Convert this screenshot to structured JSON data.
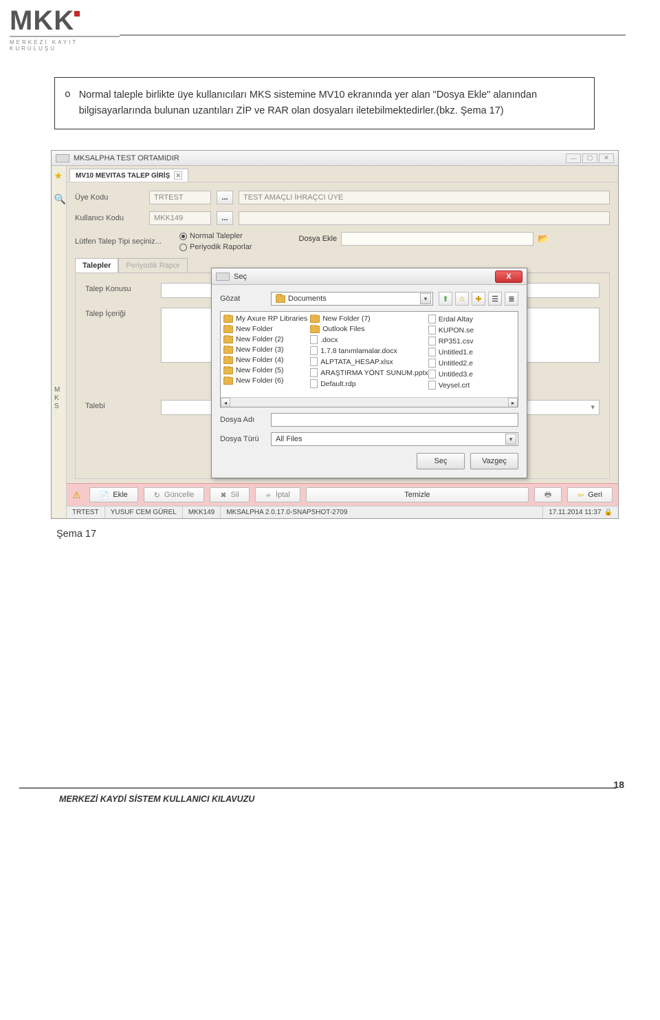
{
  "logo_text": "MKK",
  "logo_sub": "MERKEZİ KAYIT KURULUŞU",
  "textbox_bullet_marker": "o",
  "textbox_text": "Normal taleple birlikte üye kullanıcıları MKS sistemine MV10 ekranında yer alan \"Dosya Ekle\" alanından bilgisayarlarında bulunan uzantıları ZİP ve RAR olan dosyaları iletebilmektedirler.(bkz. Şema 17)",
  "app": {
    "title": "MKSALPHA TEST ORTAMIDIR",
    "tab_title": "MV10 MEVITAS TALEP GİRİŞ",
    "form": {
      "uye_kodu_label": "Üye Kodu",
      "uye_kodu_value": "TRTEST",
      "uye_kodu_desc": "TEST AMAÇLI İHRAÇCI ÜYE",
      "kullanici_kodu_label": "Kullanıcı Kodu",
      "kullanici_kodu_value": "MKK149",
      "talep_tipi_label": "Lütfen Talep Tipi seçiniz...",
      "radio1": "Normal Talepler",
      "radio2": "Periyodik Raporlar",
      "dosya_ekle_label": "Dosya Ekle"
    },
    "tabs2": {
      "t1": "Talepler",
      "t2": "Periyodik Rapor"
    },
    "panel": {
      "talep_konusu": "Talep Konusu",
      "talep_icerigi": "Talep İçeriği",
      "talebi": "Talebi"
    },
    "mks_letters": "M\nK\nS",
    "toolbar": {
      "ekle": "Ekle",
      "guncelle": "Güncelle",
      "sil": "Sil",
      "iptal": "İptal",
      "temizle": "Temizle",
      "geri": "Geri"
    },
    "status": {
      "s1": "TRTEST",
      "s2": "YUSUF CEM GÜREL",
      "s3": "MKK149",
      "s4": "MKSALPHA 2.0.17.0-SNAPSHOT-2709",
      "time": "17.11.2014 11:37"
    }
  },
  "dialog": {
    "title": "Seç",
    "gozat": "Gözat",
    "location": "Documents",
    "col1": [
      "My Axure RP Libraries",
      "New Folder",
      "New Folder (2)",
      "New Folder (3)",
      "New Folder (4)",
      "New Folder (5)",
      "New Folder (6)"
    ],
    "col2": [
      "New Folder (7)",
      "Outlook Files",
      ".docx",
      "1.7.8 tanımlamalar.docx",
      "ALPTATA_HESAP.xlsx",
      "ARAŞTIRMA YÖNT  SUNUM.pptx",
      "Default.rdp"
    ],
    "col3": [
      "Erdal Altay",
      "KUPON.se",
      "RP351.csv",
      "Untitled1.e",
      "Untitled2.e",
      "Untitled3.e",
      "Veysel.crt"
    ],
    "col1_types": [
      "folder",
      "folder",
      "folder",
      "folder",
      "folder",
      "folder",
      "folder"
    ],
    "col2_types": [
      "folder",
      "folder",
      "file",
      "file",
      "file",
      "file",
      "file"
    ],
    "col3_types": [
      "file",
      "file",
      "file",
      "file",
      "file",
      "file",
      "file"
    ],
    "dosya_adi_label": "Dosya Adı",
    "dosya_turu_label": "Dosya Türü",
    "dosya_turu_value": "All Files",
    "btn_sec": "Seç",
    "btn_vazgec": "Vazgeç"
  },
  "caption": "Şema 17",
  "page_number": "18",
  "footer": "MERKEZİ KAYDİ SİSTEM  KULLANICI KILAVUZU"
}
